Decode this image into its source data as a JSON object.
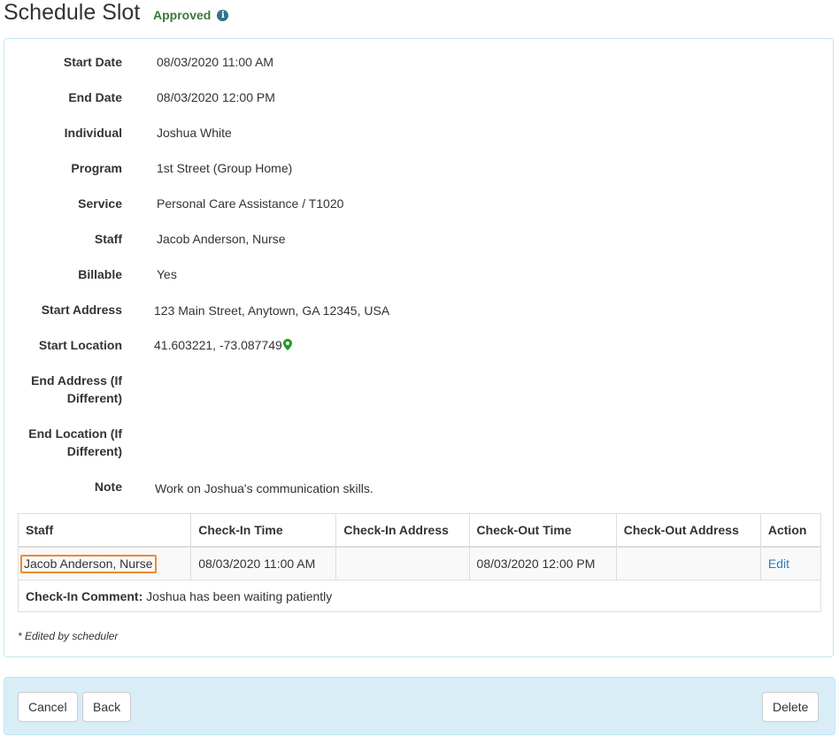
{
  "header": {
    "title": "Schedule Slot",
    "status": "Approved",
    "info_icon": "info-icon"
  },
  "details": {
    "start_date": {
      "label": "Start Date",
      "value": "08/03/2020 11:00 AM"
    },
    "end_date": {
      "label": "End Date",
      "value": "08/03/2020 12:00 PM"
    },
    "individual": {
      "label": "Individual",
      "value": "Joshua White"
    },
    "program": {
      "label": "Program",
      "value": "1st Street (Group Home)"
    },
    "service": {
      "label": "Service",
      "value": "Personal Care Assistance / T1020"
    },
    "staff": {
      "label": "Staff",
      "value": "Jacob Anderson, Nurse"
    },
    "billable": {
      "label": "Billable",
      "value": "Yes"
    },
    "start_address": {
      "label": "Start Address",
      "value": "123 Main Street, Anytown, GA 12345, USA"
    },
    "start_location": {
      "label": "Start Location",
      "value": "41.603221, -73.087749",
      "icon": "map-marker-icon"
    },
    "end_address": {
      "label_line1": "End Address (If",
      "label_line2": "Different)",
      "value": ""
    },
    "end_location": {
      "label_line1": "End Location (If",
      "label_line2": "Different)",
      "value": ""
    },
    "note": {
      "label": "Note",
      "value": "Work on Joshua's communication skills."
    }
  },
  "checkin_table": {
    "headers": [
      "Staff",
      "Check-In Time",
      "Check-In Address",
      "Check-Out Time",
      "Check-Out Address",
      "Action"
    ],
    "rows": [
      {
        "staff": "Jacob Anderson, Nurse",
        "checkin_time": "08/03/2020 11:00 AM",
        "checkin_address": "",
        "checkout_time": "08/03/2020 12:00 PM",
        "checkout_address": "",
        "action": "Edit"
      }
    ],
    "comment_label": "Check-In Comment:",
    "comment_text": "Joshua has been waiting patiently"
  },
  "footnote": "* Edited by scheduler",
  "footer": {
    "cancel_label": "Cancel",
    "back_label": "Back",
    "delete_label": "Delete"
  },
  "colors": {
    "status_green": "#3c763d",
    "info_blue": "#31708f",
    "link_blue": "#337ab7",
    "highlight_orange": "#f0882f",
    "panel_border": "#bce8f1",
    "footer_bg": "#d9edf7",
    "pin_green": "#1e9e1e"
  }
}
